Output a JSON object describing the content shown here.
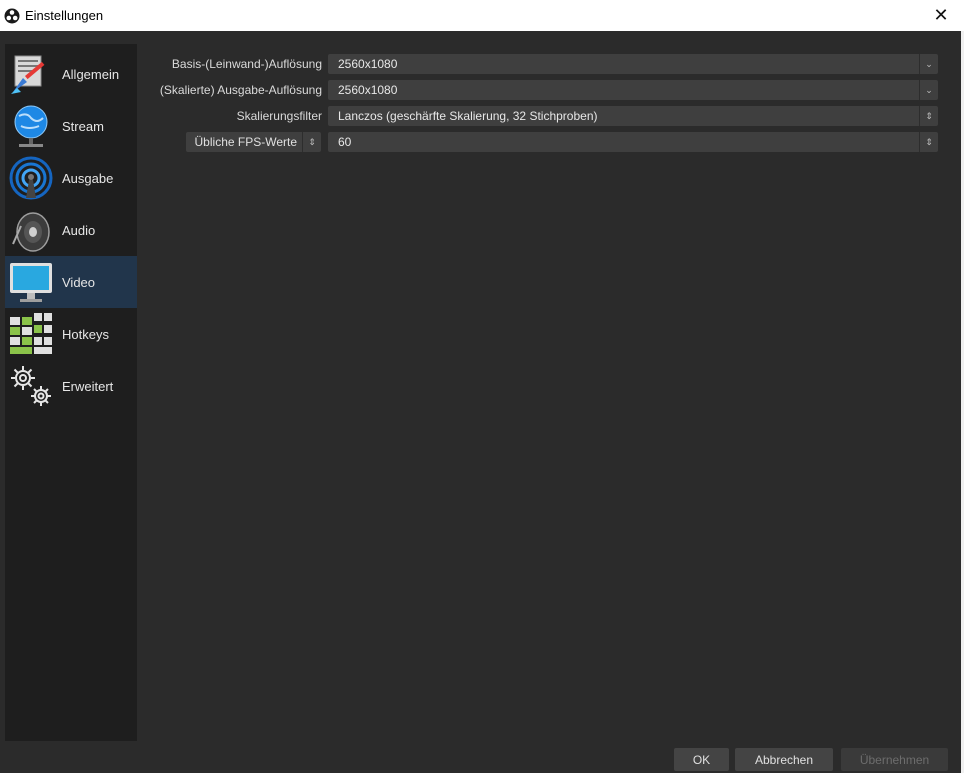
{
  "window": {
    "title": "Einstellungen",
    "close_symbol": "✕"
  },
  "sidebar": {
    "items": [
      {
        "label": "Allgemein",
        "icon": "general-settings-icon"
      },
      {
        "label": "Stream",
        "icon": "globe-stream-icon"
      },
      {
        "label": "Ausgabe",
        "icon": "broadcast-antenna-icon"
      },
      {
        "label": "Audio",
        "icon": "speaker-icon"
      },
      {
        "label": "Video",
        "icon": "monitor-icon",
        "active": true
      },
      {
        "label": "Hotkeys",
        "icon": "keyboard-icon"
      },
      {
        "label": "Erweitert",
        "icon": "gears-icon"
      }
    ]
  },
  "video": {
    "base_resolution": {
      "label": "Basis-(Leinwand-)Auflösung",
      "value": "2560x1080"
    },
    "output_resolution": {
      "label": "(Skalierte) Ausgabe-Auflösung",
      "value": "2560x1080"
    },
    "downscale_filter": {
      "label": "Skalierungsfilter",
      "value": "Lanczos (geschärfte Skalierung, 32 Stichproben)"
    },
    "fps": {
      "label": "Übliche FPS-Werte",
      "value": "60"
    }
  },
  "buttons": {
    "ok": "OK",
    "cancel": "Abbrechen",
    "apply": "Übernehmen"
  },
  "colors": {
    "active_item": "#21354b",
    "background": "#2b2b2b",
    "sidebar": "#1e1e1e"
  }
}
